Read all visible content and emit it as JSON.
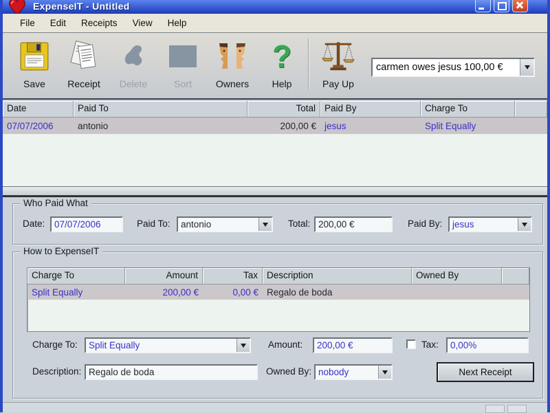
{
  "window": {
    "title": "ExpenseIT - Untitled"
  },
  "menu": {
    "items": [
      "File",
      "Edit",
      "Receipts",
      "View",
      "Help"
    ]
  },
  "toolbar": {
    "buttons": [
      {
        "label": "Save",
        "icon": "floppy-disk-icon",
        "enabled": true
      },
      {
        "label": "Receipt",
        "icon": "receipt-icon",
        "enabled": true
      },
      {
        "label": "Delete",
        "icon": "delete-icon",
        "enabled": false
      },
      {
        "label": "Sort",
        "icon": "sort-icon",
        "enabled": false
      },
      {
        "label": "Owners",
        "icon": "owners-faces-icon",
        "enabled": true
      },
      {
        "label": "Help",
        "icon": "question-mark-icon",
        "enabled": true
      },
      {
        "label": "Pay Up",
        "icon": "balance-scales-icon",
        "enabled": true
      }
    ],
    "balance_dropdown": {
      "value": "carmen owes jesus 100,00 €"
    }
  },
  "icons": {
    "help_glyph": "?"
  },
  "receipts_table": {
    "headers": [
      "Date",
      "Paid To",
      "Total",
      "Paid By",
      "Charge To"
    ],
    "rows": [
      {
        "date": "07/07/2006",
        "paid_to": "antonio",
        "total": "200,00 €",
        "paid_by": "jesus",
        "charge_to": "Split Equally"
      }
    ]
  },
  "who_paid_what": {
    "title": "Who Paid What",
    "date_label": "Date:",
    "date_value": "07/07/2006",
    "paid_to_label": "Paid To:",
    "paid_to_value": "antonio",
    "total_label": "Total:",
    "total_value": "200,00 €",
    "paid_by_label": "Paid By:",
    "paid_by_value": "jesus"
  },
  "how_to_expenseit": {
    "title": "How to ExpenseIT",
    "table": {
      "headers": [
        "Charge To",
        "Amount",
        "Tax",
        "Description",
        "Owned By"
      ],
      "rows": [
        {
          "charge_to": "Split Equally",
          "amount": "200,00 €",
          "tax": "0,00 €",
          "description": "Regalo de boda",
          "owned_by": ""
        }
      ]
    },
    "charge_to_label": "Charge To:",
    "charge_to_value": "Split Equally",
    "amount_label": "Amount:",
    "amount_value": "200,00 €",
    "tax_label": "Tax:",
    "tax_value": "0,00%",
    "tax_checked": false,
    "description_label": "Description:",
    "description_value": "Regalo de boda",
    "owned_by_label": "Owned By:",
    "owned_by_value": "nobody",
    "next_receipt_button": "Next Receipt"
  },
  "colors": {
    "link_text_blue": "#3b2fc9",
    "titlebar_blue": "#1c3cb8",
    "close_button_red": "#c33c1d",
    "panel_background": "#cbd2d9",
    "table_background": "#edf3ee",
    "selected_row": "#c9c5c9"
  }
}
